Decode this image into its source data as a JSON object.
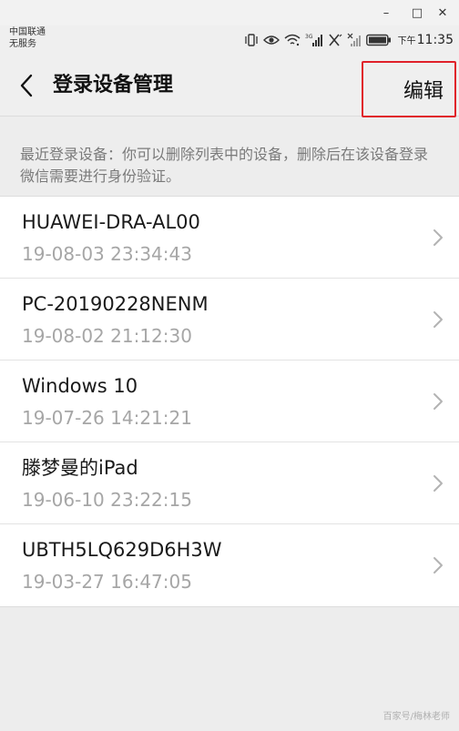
{
  "window": {
    "minimize": "–",
    "maximize": "□",
    "close": "✕"
  },
  "status_bar": {
    "carrier_line1": "中国联通",
    "carrier_line2": "无服务",
    "time_prefix": "下午",
    "time": "11:35",
    "icons": [
      "vibrate-icon",
      "eye-icon",
      "wifi-icon",
      "signal-3g-icon",
      "no-signal-icon",
      "battery-icon"
    ]
  },
  "header": {
    "title": "登录设备管理",
    "edit_label": "编辑"
  },
  "hint": "最近登录设备：你可以删除列表中的设备，删除后在该设备登录微信需要进行身份验证。",
  "devices": [
    {
      "name": "HUAWEI-DRA-AL00",
      "time": "19-08-03 23:34:43"
    },
    {
      "name": "PC-20190228NENM",
      "time": "19-08-02 21:12:30"
    },
    {
      "name": "Windows 10",
      "time": "19-07-26 14:21:21"
    },
    {
      "name": "滕梦曼的iPad",
      "time": "19-06-10 23:22:15"
    },
    {
      "name": "UBTH5LQ629D6H3W",
      "time": "19-03-27 16:47:05"
    }
  ],
  "watermark": "百家号/梅林老师",
  "colors": {
    "highlight_border": "#e0202a",
    "secondary_text": "#a6a6a6",
    "hint_text": "#7a7a7a"
  }
}
